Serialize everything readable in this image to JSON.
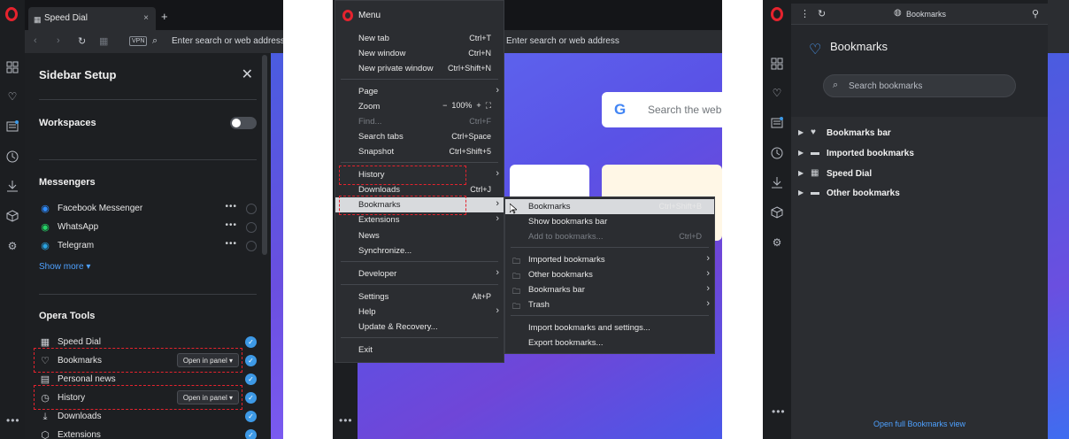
{
  "panel1": {
    "tab_title": "Speed Dial",
    "new_tab_symbol": "+",
    "vpn_label": "VPN",
    "address_placeholder": "Enter search or web address",
    "sidebar_setup": {
      "title": "Sidebar Setup",
      "workspaces_label": "Workspaces",
      "messengers_title": "Messengers",
      "messengers": [
        {
          "label": "Facebook Messenger",
          "icon": "messenger-icon"
        },
        {
          "label": "WhatsApp",
          "icon": "whatsapp-icon"
        },
        {
          "label": "Telegram",
          "icon": "telegram-icon"
        }
      ],
      "show_more": "Show more",
      "opera_tools_title": "Opera Tools",
      "tools": [
        {
          "label": "Speed Dial",
          "icon": "speed-dial-icon",
          "panel_label": ""
        },
        {
          "label": "Bookmarks",
          "icon": "heart-icon",
          "panel_label": "Open in panel"
        },
        {
          "label": "Personal news",
          "icon": "news-icon",
          "panel_label": ""
        },
        {
          "label": "History",
          "icon": "clock-icon",
          "panel_label": "Open in panel"
        },
        {
          "label": "Downloads",
          "icon": "download-icon",
          "panel_label": ""
        },
        {
          "label": "Extensions",
          "icon": "cube-icon",
          "panel_label": ""
        }
      ]
    }
  },
  "panel2": {
    "address_placeholder": "Enter search or web address",
    "google_search_placeholder": "Search the web",
    "menu": {
      "title": "Menu",
      "items": [
        {
          "label": "New tab",
          "shortcut": "Ctrl+T"
        },
        {
          "label": "New window",
          "shortcut": "Ctrl+N"
        },
        {
          "label": "New private window",
          "shortcut": "Ctrl+Shift+N"
        },
        {
          "label": "Page",
          "shortcut": ""
        },
        {
          "label": "Zoom",
          "shortcut": ""
        },
        {
          "label": "Find...",
          "shortcut": "Ctrl+F"
        },
        {
          "label": "Search tabs",
          "shortcut": "Ctrl+Space"
        },
        {
          "label": "Snapshot",
          "shortcut": "Ctrl+Shift+5"
        },
        {
          "label": "History",
          "shortcut": ""
        },
        {
          "label": "Downloads",
          "shortcut": "Ctrl+J"
        },
        {
          "label": "Bookmarks",
          "shortcut": ""
        },
        {
          "label": "Extensions",
          "shortcut": ""
        },
        {
          "label": "News",
          "shortcut": ""
        },
        {
          "label": "Synchronize...",
          "shortcut": ""
        },
        {
          "label": "Developer",
          "shortcut": ""
        },
        {
          "label": "Settings",
          "shortcut": "Alt+P"
        },
        {
          "label": "Help",
          "shortcut": ""
        },
        {
          "label": "Update & Recovery...",
          "shortcut": ""
        },
        {
          "label": "Exit",
          "shortcut": ""
        }
      ],
      "zoom_value": "100%",
      "zoom_minus": "−",
      "zoom_plus": "+"
    },
    "bookmarks_submenu": [
      {
        "label": "Bookmarks",
        "shortcut": "Ctrl+Shift+B"
      },
      {
        "label": "Show bookmarks bar",
        "shortcut": ""
      },
      {
        "label": "Add to bookmarks...",
        "shortcut": "Ctrl+D"
      },
      {
        "label": "Imported bookmarks",
        "shortcut": ""
      },
      {
        "label": "Other bookmarks",
        "shortcut": ""
      },
      {
        "label": "Bookmarks bar",
        "shortcut": ""
      },
      {
        "label": "Trash",
        "shortcut": ""
      },
      {
        "label": "Import bookmarks and settings...",
        "shortcut": ""
      },
      {
        "label": "Export bookmarks...",
        "shortcut": ""
      }
    ]
  },
  "panel3": {
    "top_title": "Bookmarks",
    "header_title": "Bookmarks",
    "search_placeholder": "Search bookmarks",
    "folders": [
      {
        "label": "Bookmarks bar",
        "icon": "heart-icon"
      },
      {
        "label": "Imported bookmarks",
        "icon": "folder-icon"
      },
      {
        "label": "Speed Dial",
        "icon": "speed-dial-icon"
      },
      {
        "label": "Other bookmarks",
        "icon": "folder-icon"
      }
    ],
    "footer_link": "Open full Bookmarks view"
  },
  "colors": {
    "opera_red": "#e5232e",
    "accent_blue": "#4ea1ff",
    "check_blue": "#3d99e6",
    "highlight_box": "#e5232e"
  }
}
